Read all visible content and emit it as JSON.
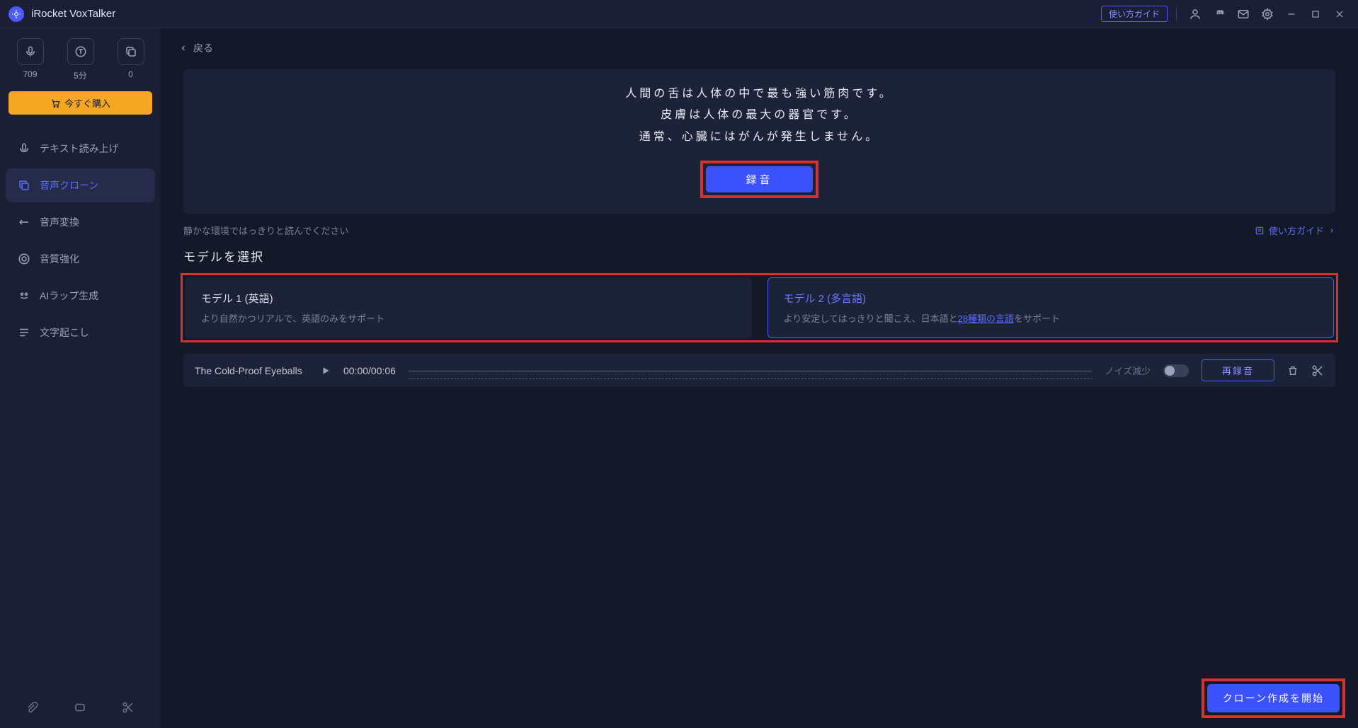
{
  "app": {
    "title": "iRocket VoxTalker"
  },
  "titlebar": {
    "usage_guide": "使い方ガイド"
  },
  "sidebar": {
    "stats": [
      {
        "value": "709"
      },
      {
        "value": "5分"
      },
      {
        "value": "0"
      }
    ],
    "buy_now": "今すぐ購入",
    "items": [
      {
        "label": "テキスト読み上げ"
      },
      {
        "label": "音声クローン"
      },
      {
        "label": "音声変換"
      },
      {
        "label": "音質強化"
      },
      {
        "label": "AIラップ生成"
      },
      {
        "label": "文字起こし"
      }
    ]
  },
  "main": {
    "back": "戻る",
    "script_lines": {
      "l1": "人間の舌は人体の中で最も強い筋肉です。",
      "l2": "皮膚は人体の最大の器官です。",
      "l3": "通常、心臓にはがんが発生しません。"
    },
    "record_button": "録音",
    "hint": "静かな環境ではっきりと読んでください",
    "guide_link": "使い方ガイド",
    "model_section_title": "モデルを選択",
    "models": {
      "m1": {
        "title": "モデル 1 (英語)",
        "desc": "より自然かつリアルで、英語のみをサポート"
      },
      "m2": {
        "title": "モデル 2 (多言語)",
        "desc_pre": "より安定してはっきりと聞こえ、日本語と",
        "link": "28種類の言語",
        "desc_post": "をサポート"
      }
    },
    "recording": {
      "name": "The Cold-Proof Eyeballs",
      "time": "00:00/00:06",
      "noise_label": "ノイズ減少",
      "rerecord": "再録音"
    },
    "start_clone": "クローン作成を開始"
  }
}
